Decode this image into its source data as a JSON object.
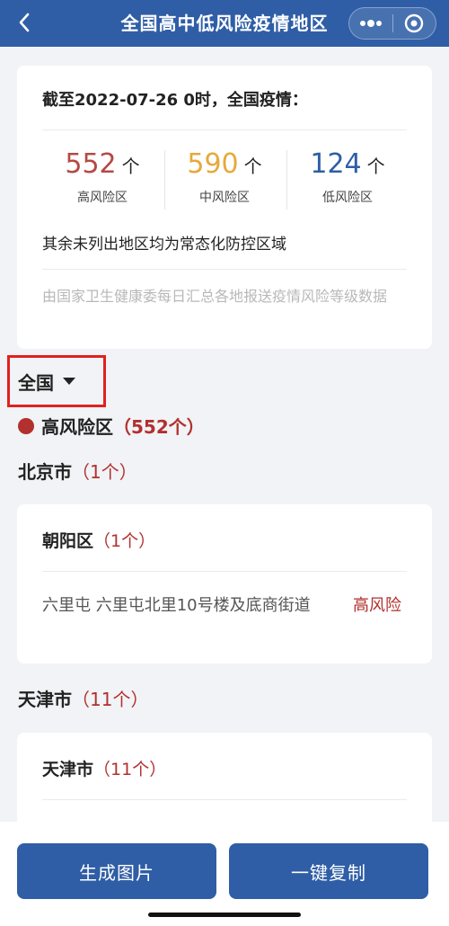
{
  "nav": {
    "title": "全国高中低风险疫情地区",
    "back_icon": "chevron-left-icon",
    "more_icon": "more-dots-icon",
    "close_icon": "target-circle-icon"
  },
  "summary": {
    "heading": "截至2022-07-26 0时，全国疫情：",
    "stats": [
      {
        "value": "552",
        "unit": "个",
        "label": "高风险区",
        "color": "#b44a45"
      },
      {
        "value": "590",
        "unit": "个",
        "label": "中风险区",
        "color": "#e7a93b"
      },
      {
        "value": "124",
        "unit": "个",
        "label": "低风险区",
        "color": "#2f5ea6"
      }
    ],
    "rest_note": "其余未列出地区均为常态化防控区域",
    "source_note": "由国家卫生健康委每日汇总各地报送疫情风险等级数据"
  },
  "filter": {
    "label": "全国"
  },
  "level_section": {
    "title": "高风险区",
    "count": "（552个）",
    "dot_color": "#b2302e"
  },
  "cities": [
    {
      "name": "北京市",
      "count": "（1个）",
      "district": {
        "name": "朝阳区",
        "count": "（1个）",
        "address": "六里屯   六里屯北里10号楼及底商街道",
        "risk": "高风险"
      }
    },
    {
      "name": "天津市",
      "count": "（11个）",
      "district": {
        "name": "天津市",
        "count": "（11个）"
      }
    }
  ],
  "actions": {
    "generate_image": "生成图片",
    "copy_all": "一键复制"
  },
  "colors": {
    "primary": "#2f5ea6",
    "high_risk": "#b2302e",
    "medium_risk": "#e7a93b",
    "low_risk": "#2f5ea6",
    "highlight_border": "#e0211f"
  }
}
